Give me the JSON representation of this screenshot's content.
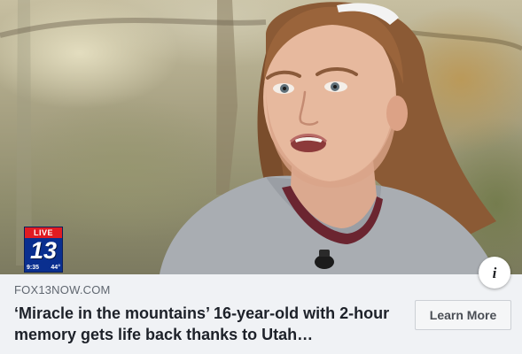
{
  "ad": {
    "source": "FOX13NOW.COM",
    "headline": "‘Miracle in the mountains’ 16-year-old with 2-hour memory gets life back thanks to Utah…",
    "cta_label": "Learn More",
    "info_icon": "i"
  },
  "station_bug": {
    "live_label": "LIVE",
    "channel_number": "13",
    "time": "9:35",
    "temperature": "44°"
  },
  "colors": {
    "page_background": "#f0f2f5",
    "headline": "#1d2129",
    "source": "#606770",
    "bug_blue": "#0a2f8f",
    "bug_red": "#e11b22"
  }
}
